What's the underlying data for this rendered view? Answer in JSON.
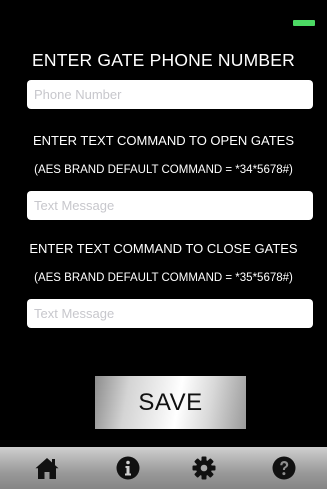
{
  "status_bar": {
    "battery_color": "#4cd964"
  },
  "phone_section": {
    "heading": "ENTER GATE PHONE NUMBER",
    "placeholder": "Phone Number",
    "value": ""
  },
  "open_section": {
    "heading": "ENTER TEXT COMMAND TO OPEN GATES",
    "note": "(AES BRAND DEFAULT COMMAND = *34*5678#)",
    "placeholder": "Text Message",
    "value": ""
  },
  "close_section": {
    "heading": "ENTER TEXT COMMAND TO CLOSE GATES",
    "note": "(AES BRAND DEFAULT COMMAND = *35*5678#)",
    "placeholder": "Text Message",
    "value": ""
  },
  "save_button": {
    "label": "SAVE"
  },
  "tab_bar": {
    "items": [
      {
        "icon": "home-icon"
      },
      {
        "icon": "info-icon"
      },
      {
        "icon": "gear-icon"
      },
      {
        "icon": "question-icon"
      }
    ]
  }
}
